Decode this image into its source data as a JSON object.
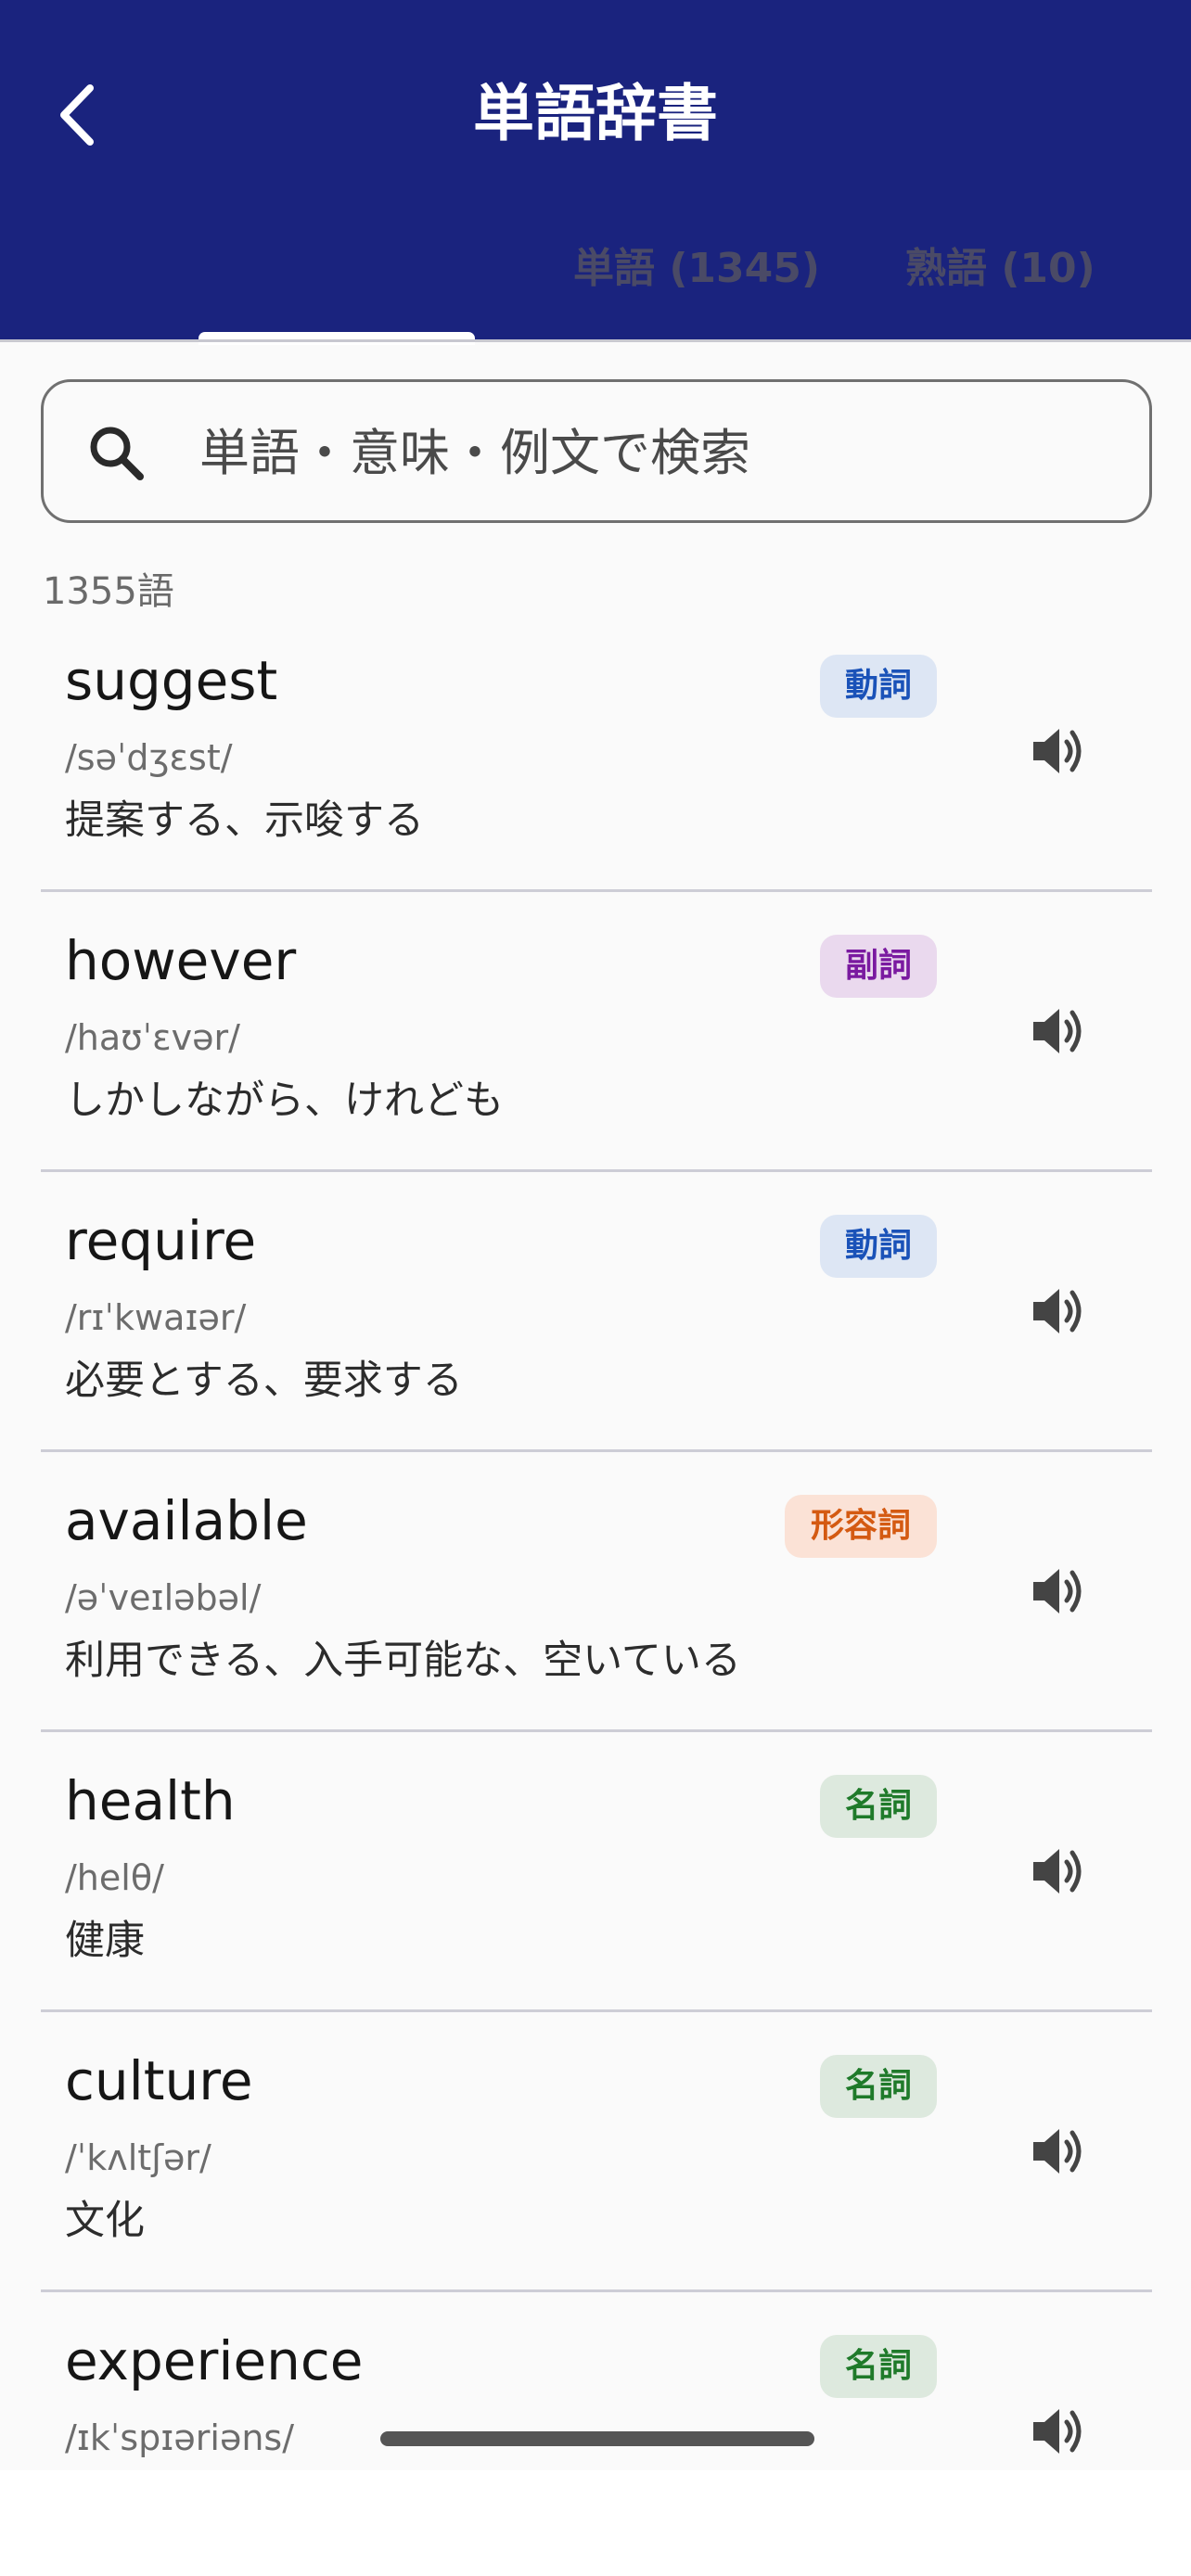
{
  "header": {
    "title": "単語辞書",
    "tabs": [
      {
        "label": ""
      },
      {
        "label": "単語 (1345)"
      },
      {
        "label": "熟語 (10)"
      }
    ]
  },
  "search": {
    "placeholder": "単語・意味・例文で検索"
  },
  "count_label": "1355語",
  "words": [
    {
      "word": "suggest",
      "ipa": "/səˈdʒɛst/",
      "meaning": "提案する、示唆する",
      "pos": "動詞",
      "pos_type": "verb"
    },
    {
      "word": "however",
      "ipa": "/haʊˈɛvər/",
      "meaning": "しかしながら、けれども",
      "pos": "副詞",
      "pos_type": "adv"
    },
    {
      "word": "require",
      "ipa": "/rɪˈkwaɪər/",
      "meaning": "必要とする、要求する",
      "pos": "動詞",
      "pos_type": "verb"
    },
    {
      "word": "available",
      "ipa": "/əˈveɪləbəl/",
      "meaning": "利用できる、入手可能な、空いている",
      "pos": "形容詞",
      "pos_type": "adj"
    },
    {
      "word": "health",
      "ipa": "/helθ/",
      "meaning": "健康",
      "pos": "名詞",
      "pos_type": "noun"
    },
    {
      "word": "culture",
      "ipa": "/ˈkʌltʃər/",
      "meaning": "文化",
      "pos": "名詞",
      "pos_type": "noun"
    },
    {
      "word": "experience",
      "ipa": "/ɪkˈspɪəriəns/",
      "meaning": "",
      "pos": "名詞",
      "pos_type": "noun"
    }
  ],
  "icons": {
    "back": "chevron-left-icon",
    "search": "search-icon",
    "speaker": "speaker-icon"
  },
  "colors": {
    "header_bg": "#1a237e",
    "verb": "#1a52b8",
    "adverb": "#7a1aa0",
    "adjective": "#d45a12",
    "noun": "#1f7a2a"
  }
}
